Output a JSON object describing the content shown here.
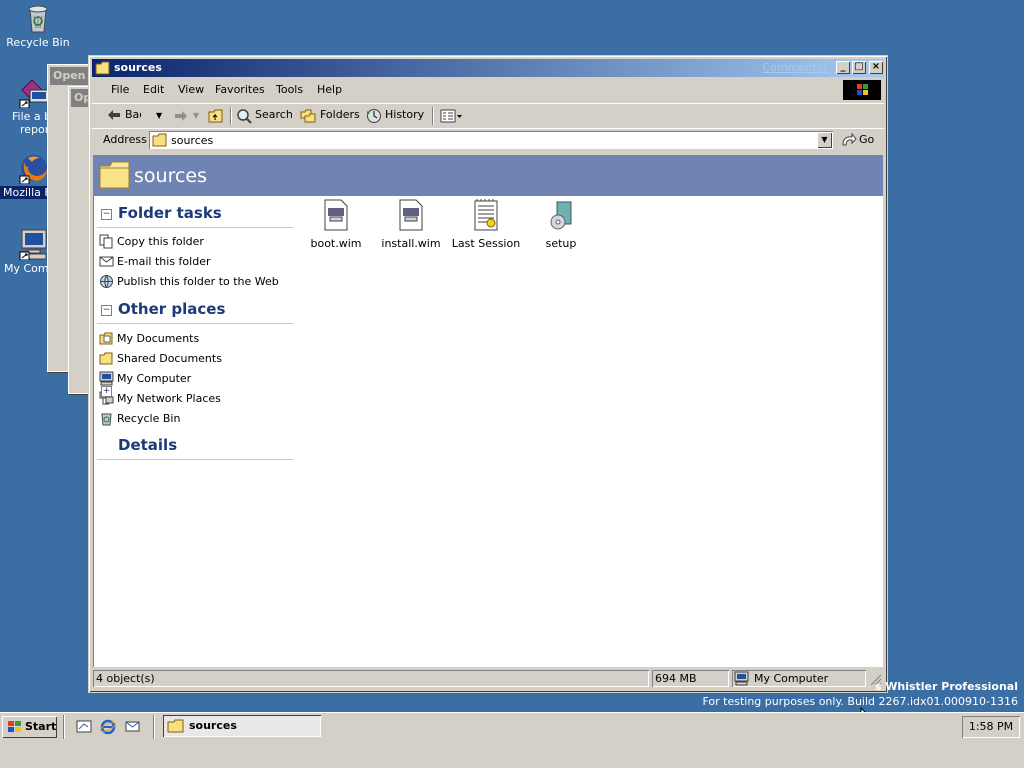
{
  "desktop": {
    "icons": [
      {
        "label": "Recycle Bin"
      },
      {
        "label": "File a b..."
      },
      {
        "label": "repor"
      },
      {
        "label": "Mozilla Fir"
      },
      {
        "label": "My Comp"
      }
    ],
    "ghost_window_titles": [
      "Open W",
      "Op"
    ],
    "watermark_line1": "s Whistler Professional",
    "watermark_line2": "For testing purposes only. Build 2267.idx01.000910-1316"
  },
  "window": {
    "title": "sources",
    "comments_link": "Comments?",
    "controls": {
      "minimize": "_",
      "maximize": "□",
      "close": "×"
    },
    "menu": [
      "File",
      "Edit",
      "View",
      "Favorites",
      "Tools",
      "Help"
    ],
    "toolbar": {
      "back": "Back",
      "search": "Search",
      "folders": "Folders",
      "history": "History"
    },
    "address": {
      "label": "Address",
      "value": "sources",
      "go": "Go"
    },
    "banner_title": "sources",
    "folder_tasks": {
      "heading": "Folder tasks",
      "toggle": "−",
      "items": [
        "Copy this folder",
        "E-mail this folder",
        "Publish this folder to the Web"
      ]
    },
    "other_places": {
      "heading": "Other places",
      "toggle": "−",
      "items": [
        "My Documents",
        "Shared Documents",
        "My Computer",
        "My Network Places",
        "Recycle Bin"
      ]
    },
    "details": {
      "heading": "Details",
      "toggle": "+"
    },
    "files": [
      {
        "name": "boot.wim",
        "icon": "wim-file-icon"
      },
      {
        "name": "install.wim",
        "icon": "wim-file-icon"
      },
      {
        "name": "Last Session",
        "icon": "text-document-icon"
      },
      {
        "name": "setup",
        "icon": "setup-cd-icon"
      }
    ],
    "status": {
      "objects": "4 object(s)",
      "size": "694 MB",
      "zone": "My Computer"
    }
  },
  "taskbar": {
    "start": "Start",
    "task_label": "sources",
    "clock": "1:58 PM"
  },
  "colors": {
    "desktop": "#3a6ea5",
    "title_active": "#0a246a",
    "banner": "#7084b4",
    "section_heading": "#1c3a7a"
  }
}
